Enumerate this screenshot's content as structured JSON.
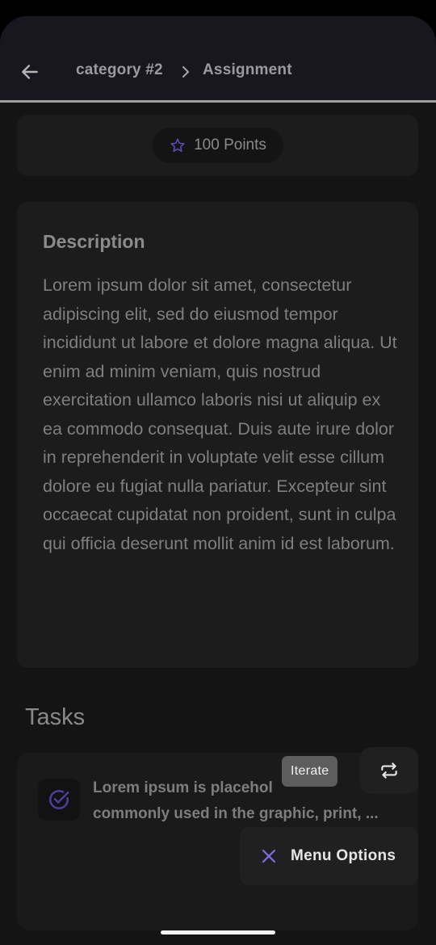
{
  "app": {
    "breadcrumb": {
      "category": "category #2",
      "current": "Assignment"
    },
    "back_icon": "arrow-left-icon",
    "separator_icon": "chevron-right-icon"
  },
  "points": {
    "label": "100 Points",
    "icon": "star-outline-icon"
  },
  "description": {
    "title": "Description",
    "body": "Lorem ipsum dolor sit amet, consectetur adipiscing elit, sed do eiusmod tempor incididunt ut labore et dolore magna aliqua. Ut enim ad minim veniam, quis nostrud exercitation ullamco laboris nisi ut aliquip ex ea commodo consequat. Duis aute irure dolor in reprehenderit in voluptate velit esse cillum dolore eu fugiat nulla pariatur. Excepteur sint occaecat cupidatat non proident, sunt in culpa qui officia deserunt mollit anim id est laborum."
  },
  "tasks": {
    "title": "Tasks",
    "items": [
      {
        "line1": "Lorem ipsum is placehol",
        "line2": "commonly used in the graphic, print, ...",
        "icon": "check-circle-icon"
      }
    ]
  },
  "fab": {
    "iterate_tooltip": "Iterate",
    "iterate_icon": "repeat-icon",
    "menu_label": "Menu Options",
    "menu_icon": "close-icon"
  },
  "colors": {
    "accent": "#6a5acd",
    "background": "#141414",
    "card": "#1c1c1c",
    "appbar": "#18171f"
  }
}
